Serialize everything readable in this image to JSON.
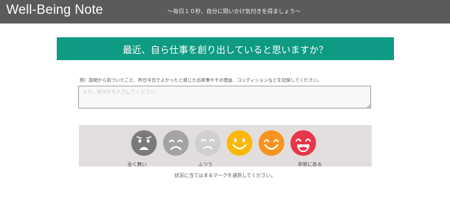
{
  "header": {
    "brand": "Well-Being Note",
    "tagline": "〜毎日１０秒、自分に問いかけ気付きを得ましょう〜"
  },
  "question": {
    "text": "最近、自ら仕事を創り出していると思いますか？"
  },
  "memo": {
    "prompt": "例）設問から気づいたこと、昨日今日でよかったと感じた出来事やその理由、コンディションなどを記録してください。",
    "placeholder": "メモ、気付きを入力してください。",
    "value": ""
  },
  "rating": {
    "options": [
      {
        "icon": "very-sad-face-icon",
        "color": "#7a7a7a"
      },
      {
        "icon": "sad-face-icon",
        "color": "#a3a3a3"
      },
      {
        "icon": "slightly-sad-face-icon",
        "color": "#cfcfcf"
      },
      {
        "icon": "smile-face-icon",
        "color": "#fbb809"
      },
      {
        "icon": "happy-face-icon",
        "color": "#f7931e"
      },
      {
        "icon": "very-happy-face-icon",
        "color": "#e8364a"
      }
    ],
    "labels": {
      "low": "全く無い",
      "mid": "ふつう",
      "high": "非常にある"
    },
    "instruction": "状況に当てはまるマークを選択してください。"
  },
  "colors": {
    "header_bg": "#5b5b5b",
    "question_bg": "#0e9a83",
    "panel_bg": "#e3dede"
  }
}
